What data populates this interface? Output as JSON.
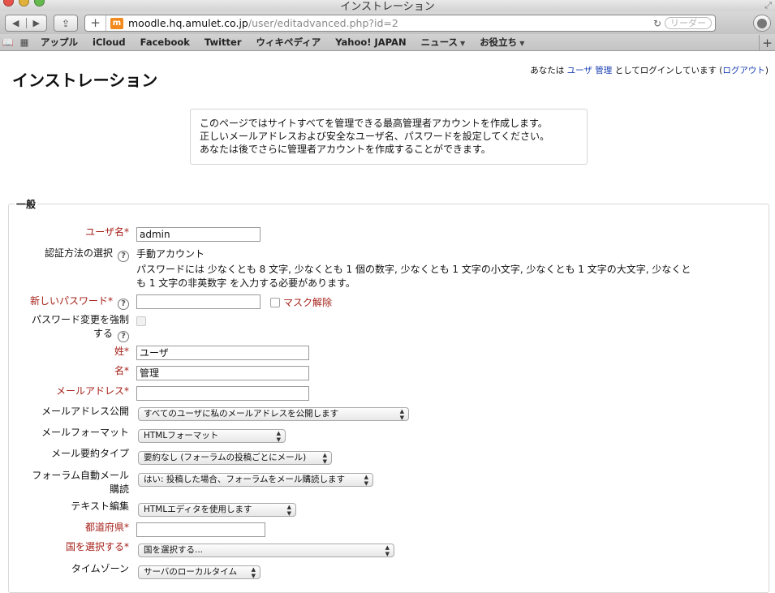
{
  "browser": {
    "window_title": "インストレーション",
    "url_host": "moodle.hq.amulet.co.jp",
    "url_path": "/user/editadvanced.php?id=2",
    "reader_label": "リーダー",
    "bookmarks": [
      {
        "label": "アップル",
        "menu": false
      },
      {
        "label": "iCloud",
        "menu": false
      },
      {
        "label": "Facebook",
        "menu": false
      },
      {
        "label": "Twitter",
        "menu": false
      },
      {
        "label": "ウィキペディア",
        "menu": false
      },
      {
        "label": "Yahoo! JAPAN",
        "menu": false
      },
      {
        "label": "ニュース",
        "menu": true
      },
      {
        "label": "お役立ち",
        "menu": true
      }
    ]
  },
  "header": {
    "login_prefix": "あなたは",
    "user_name": "ユーザ 管理",
    "login_middle": "としてログインしています (",
    "logout": "ログアウト",
    "login_suffix": ")",
    "title": "インストレーション"
  },
  "notice": {
    "line1": "このページではサイトすべてを管理できる最高管理者アカウントを作成します。",
    "line2": "正しいメールアドレスおよび安全なユーザ名、パスワードを設定してください。",
    "line3": "あなたは後でさらに管理者アカウントを作成することができます。"
  },
  "form": {
    "legend": "一般",
    "username": {
      "label": "ユーザ名",
      "value": "admin"
    },
    "auth": {
      "label": "認証方法の選択",
      "value": "手動アカウント"
    },
    "password_rule_1": "パスワードには 少なくとも 8 文字, 少なくとも 1 個の数字, 少なくとも 1 文字の小文字, 少なくとも 1 文字の大文字, 少なくと",
    "password_rule_2": "も 1 文字の非英数字 を入力する必要があります。",
    "new_password": {
      "label": "新しいパスワード",
      "value": "",
      "unmask_label": "マスク解除"
    },
    "force_change": {
      "label_line1": "パスワード変更を強制",
      "label_line2": "する"
    },
    "lastname": {
      "label": "姓",
      "value": "ユーザ"
    },
    "firstname": {
      "label": "名",
      "value": "管理"
    },
    "email": {
      "label": "メールアドレス",
      "value": ""
    },
    "email_display": {
      "label": "メールアドレス公開",
      "value": "すべてのユーザに私のメールアドレスを公開します"
    },
    "mail_format": {
      "label": "メールフォーマット",
      "value": "HTMLフォーマット"
    },
    "mail_digest": {
      "label": "メール要約タイプ",
      "value": "要約なし (フォーラムの投稿ごとにメール)"
    },
    "autosubscribe": {
      "label_line1": "フォーラム自動メール",
      "label_line2": "購読",
      "value": "はい: 投稿した場合、フォーラムをメール購読します"
    },
    "text_editor": {
      "label": "テキスト編集",
      "value": "HTMLエディタを使用します"
    },
    "city": {
      "label": "都道府県",
      "value": ""
    },
    "country": {
      "label": "国を選択する",
      "value": "国を選択する..."
    },
    "timezone": {
      "label": "タイムゾーン",
      "value": "サーバのローカルタイム"
    }
  },
  "required_marker": "*",
  "help_glyph": "?"
}
